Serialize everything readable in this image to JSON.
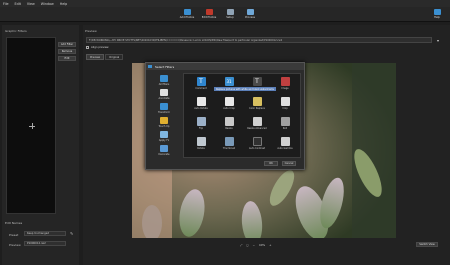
{
  "menu": [
    "File",
    "Edit",
    "View",
    "Window",
    "Help"
  ],
  "toolbar": {
    "buttons": [
      {
        "label": "Add Photos",
        "color": "#3a8fd1",
        "icon": "add-photos-icon"
      },
      {
        "label": "Edit Photos",
        "color": "#c0392b",
        "icon": "edit-photos-icon"
      },
      {
        "label": "Setup",
        "color": "#8fa3b5",
        "icon": "setup-icon"
      },
      {
        "label": "Process",
        "color": "#6fa8d8",
        "icon": "process-icon"
      },
      {
        "label": "Help",
        "color": "#3a8fd1",
        "icon": "help-icon"
      }
    ]
  },
  "left_panel": {
    "title": "Graphic Filters",
    "buttons": [
      "Add Filter",
      "Remove",
      "Edit"
    ],
    "edit_names_title": "Edit Names",
    "preset_label": "Preset",
    "preset_value": "Keep Unchanged",
    "preview_label": "Preview",
    "preview_value": "P1000012.rw2"
  },
  "preview": {
    "title": "Preview",
    "path": "F:\\DB WORKING\\---MY DRIVE STOTTS\\NET\\20201030\\PHLIBEN\\======\\Panasonic Lumix LX100\\DMC\\Raw files\\sort to particular organized\\P1000012.rw2",
    "align_label": "Align preview",
    "tabs": [
      "Preview",
      "Original"
    ],
    "zoom": "40%",
    "toggle_button": "Switch View"
  },
  "dialog": {
    "title": "Select Filters",
    "tooltip": "Replace pictures with white and black watermarks",
    "categories": [
      {
        "label": "All filters",
        "color": "#3a8fd1"
      },
      {
        "label": "Annotate",
        "color": "#e0e0e0"
      },
      {
        "label": "Transform",
        "color": "#3a8fd1"
      },
      {
        "label": "Touch Up",
        "color": "#e0b030"
      },
      {
        "label": "Apply Fx",
        "color": "#7fb6e0"
      },
      {
        "label": "Decorate",
        "color": "#5a9ad6"
      }
    ],
    "filters": [
      {
        "label": "Comment",
        "color": "#2f86cf"
      },
      {
        "label": "",
        "color": "#3a8fd1"
      },
      {
        "label": "",
        "color": "#4a4a4a"
      },
      {
        "label": "Image",
        "color": "#c04040"
      },
      {
        "label": "Auto Rotate",
        "color": "#e8e8e8"
      },
      {
        "label": "Auto Crop",
        "color": "#e8e8e8"
      },
      {
        "label": "Color Replace",
        "color": "#d8c060"
      },
      {
        "label": "Crop",
        "color": "#e0e0e0"
      },
      {
        "label": "Flip",
        "color": "#9bb0c8"
      },
      {
        "label": "Resize",
        "color": "#c8c8c8"
      },
      {
        "label": "Resize Advanced",
        "color": "#d0d0d0"
      },
      {
        "label": "Roll",
        "color": "#a0a0a0"
      },
      {
        "label": "Rotate",
        "color": "#c0c8d0"
      },
      {
        "label": "Thumbnail",
        "color": "#7a9ab8"
      },
      {
        "label": "Auto Contrast",
        "color": "#303030"
      },
      {
        "label": "Auto Gamma",
        "color": "#d0d0d0"
      }
    ],
    "ok": "OK",
    "cancel": "Cancel"
  }
}
